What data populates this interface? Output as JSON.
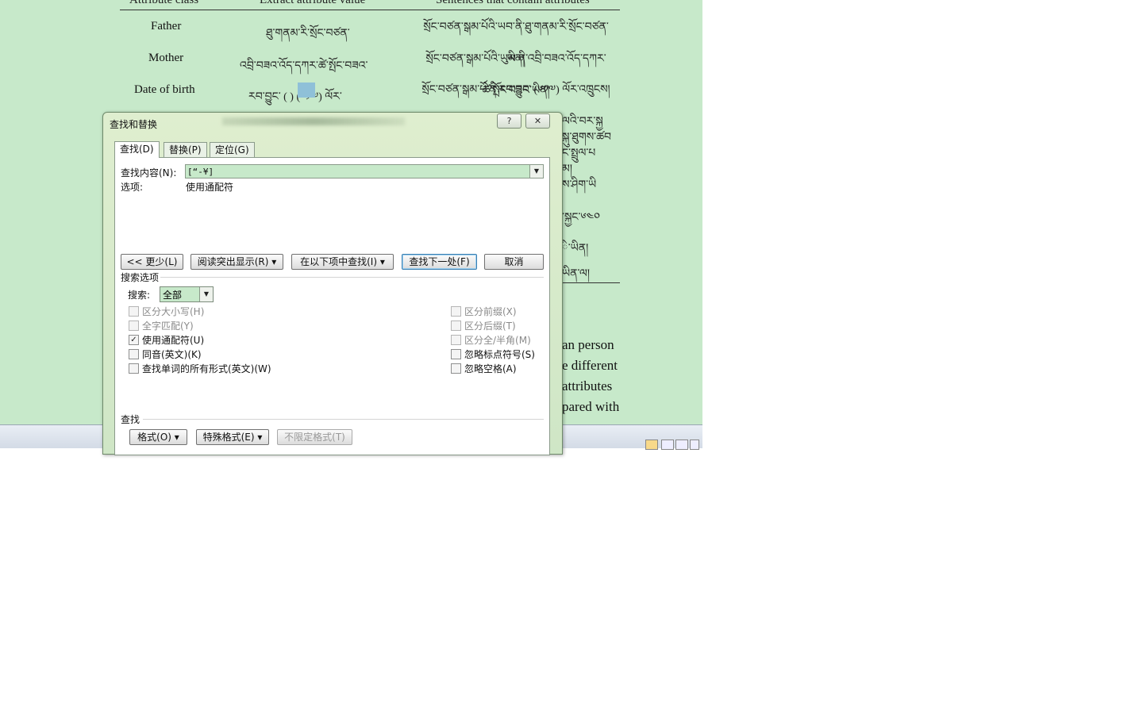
{
  "document": {
    "table_headers": [
      "Attribute class",
      "Extract attribute value",
      "Sentences that contain attributes"
    ],
    "rows": [
      {
        "class": "Father",
        "value": "ཐུ་གནམ་རི་སྲོང་བཙན་",
        "sentence": "སྲོང་བཙན་སྒམ་པོའི་ཡབ་ནི་ཐུ་གནམ་རི་སྲོང་བཙན་ཡིན།"
      },
      {
        "class": "Mother",
        "value": "འབྲི་བཟའ་འོད་དཀར་ཚེ་སྤོང་བཟའ་",
        "sentence": "སྲོང་བཙན་སྒམ་པོའི་ཡུམ་ནི་འབྲི་བཟའ་འོད་དཀར་ཚེ་སྤོང་བཟའ་ཡིན།"
      },
      {
        "class": "Date of birth",
        "value": "རབ་བྱུང་ ( ) (༦༡༧) ལོར་",
        "sentence": "སྲོང་བཙན་སྒམ་པོ་ནི་རབ་བྱུང་ (༦༡༧) ལོར་འཁྲུངས།"
      }
    ],
    "right_fragments": [
      "ལའི་བར་སྐྱ",
      "སྐུ་ཐུགས་ཚབ",
      "ང་སྤྲུལ་པ",
      "མ།",
      "ས་ཤིག་ཡི",
      "་སྐྱང་༦༤༠",
      "ི་ཡིན།",
      "ཡིན་ལ།"
    ],
    "para_fragments": [
      "an person",
      "e different",
      "attributes",
      "pared with"
    ]
  },
  "dialog": {
    "title": "查找和替换",
    "help_label": "?",
    "close_label": "✕",
    "tabs": [
      "查找(D)",
      "替换(P)",
      "定位(G)"
    ],
    "find_label": "查找内容(N):",
    "find_value": "[“-¥]",
    "options_label": "选项:",
    "options_value": "使用通配符",
    "buttons": {
      "less": "<< 更少(L)",
      "reading_highlight": "阅读突出显示(R) ▾",
      "find_in": "在以下项中查找(I) ▾",
      "find_next": "查找下一处(F)",
      "cancel": "取消"
    },
    "search_options_title": "搜索选项",
    "search_label": "搜索:",
    "search_value": "全部",
    "options_left": [
      {
        "label": "区分大小写(H)",
        "checked": false,
        "enabled": false
      },
      {
        "label": "全字匹配(Y)",
        "checked": false,
        "enabled": false
      },
      {
        "label": "使用通配符(U)",
        "checked": true,
        "enabled": true
      },
      {
        "label": "同音(英文)(K)",
        "checked": false,
        "enabled": true
      },
      {
        "label": "查找单词的所有形式(英文)(W)",
        "checked": false,
        "enabled": true
      }
    ],
    "options_right": [
      {
        "label": "区分前缀(X)",
        "checked": false,
        "enabled": false
      },
      {
        "label": "区分后缀(T)",
        "checked": false,
        "enabled": false
      },
      {
        "label": "区分全/半角(M)",
        "checked": false,
        "enabled": false
      },
      {
        "label": "忽略标点符号(S)",
        "checked": false,
        "enabled": true
      },
      {
        "label": "忽略空格(A)",
        "checked": false,
        "enabled": true
      }
    ],
    "find_section_title": "查找",
    "format_buttons": {
      "format": "格式(O) ▾",
      "special": "特殊格式(E) ▾",
      "no_format": "不限定格式(T)"
    }
  }
}
